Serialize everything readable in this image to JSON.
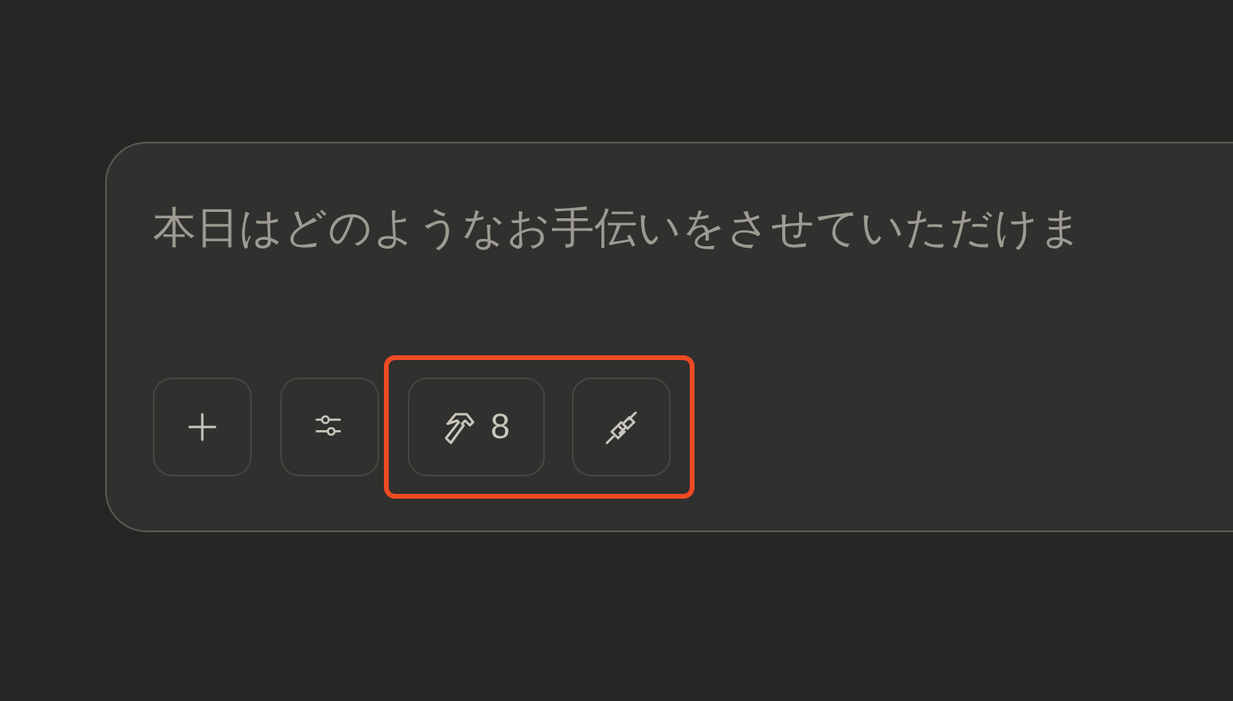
{
  "composer": {
    "placeholder": "本日はどのようなお手伝いをさせていただけま",
    "buttons": [
      {
        "kind": "plus"
      },
      {
        "kind": "sliders"
      }
    ],
    "highlighted_buttons": [
      {
        "kind": "hammer",
        "label": "8"
      },
      {
        "kind": "plug"
      }
    ]
  }
}
